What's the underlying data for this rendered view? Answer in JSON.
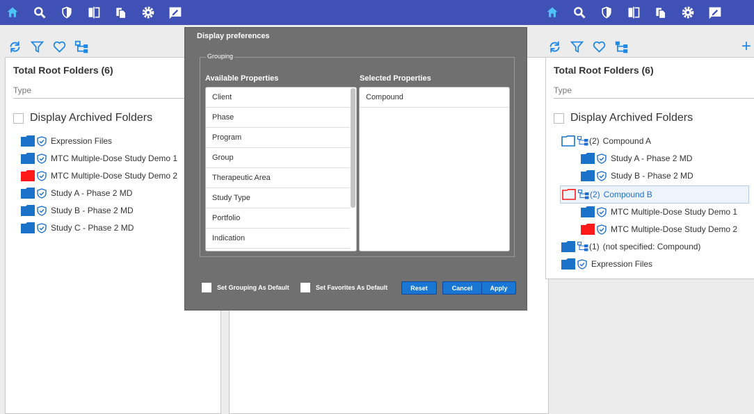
{
  "topbar_icons": [
    "home-icon",
    "search-icon",
    "shield-icon",
    "compare-icon",
    "copy-icon",
    "gear-icon",
    "edit-icon"
  ],
  "colors": {
    "topbar": "#3f51b5",
    "accent": "#1e88e5",
    "folder_blue": "#1a73c9",
    "folder_red": "#ff1a1a",
    "dialog_bg": "#707070",
    "button": "#1976d2"
  },
  "left_panel": {
    "title": "Total Root Folders (6)",
    "type_label": "Type",
    "archived_label": "Display Archived Folders",
    "items": [
      {
        "label": "Expression Files",
        "color": "blue"
      },
      {
        "label": "MTC Multiple-Dose Study Demo 1",
        "color": "blue"
      },
      {
        "label": "MTC Multiple-Dose Study Demo 2",
        "color": "red"
      },
      {
        "label": "Study A - Phase 2 MD",
        "color": "blue"
      },
      {
        "label": "Study B - Phase 2 MD",
        "color": "blue"
      },
      {
        "label": "Study C - Phase 2 MD",
        "color": "blue"
      }
    ]
  },
  "right_panel": {
    "title": "Total Root Folders (6)",
    "type_label": "Type",
    "archived_label": "Display Archived Folders",
    "groups": {
      "compound_a": {
        "count": "(2)",
        "label": "Compound A",
        "children": [
          "Study A - Phase 2 MD",
          "Study B - Phase 2 MD"
        ]
      },
      "compound_b": {
        "count": "(2)",
        "label": "Compound B",
        "children": [
          "MTC Multiple-Dose Study Demo 1",
          "MTC Multiple-Dose Study Demo 2"
        ]
      },
      "unspecified": {
        "count": "(1)",
        "label": "(not specified: Compound)"
      }
    },
    "expression_files": "Expression Files"
  },
  "dialog": {
    "title": "Display preferences",
    "grouping_legend": "Grouping",
    "available_heading": "Available Properties",
    "selected_heading": "Selected Properties",
    "available": [
      "Client",
      "Phase",
      "Program",
      "Group",
      "Therapeutic Area",
      "Study Type",
      "Portfolio",
      "Indication"
    ],
    "selected": [
      "Compound"
    ],
    "set_grouping_default": "Set Grouping As Default",
    "set_favorites_default": "Set Favorites As Default",
    "reset": "Reset",
    "cancel": "Cancel",
    "apply": "Apply"
  }
}
